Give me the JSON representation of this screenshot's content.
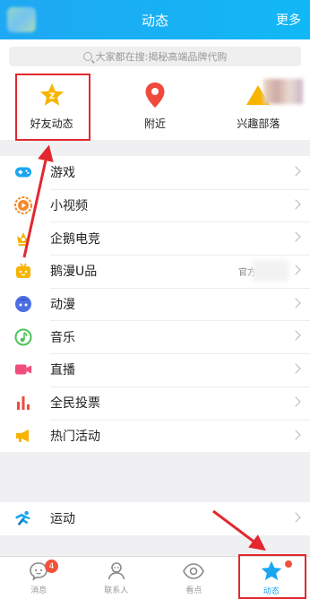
{
  "header": {
    "title": "动态",
    "more_label": "更多"
  },
  "search": {
    "placeholder": "大家都在搜:揭秘高端品牌代购"
  },
  "quick": [
    {
      "label": "好友动态",
      "icon": "friend-star-icon",
      "color": "#f7b500"
    },
    {
      "label": "附近",
      "icon": "location-pin-icon",
      "color": "#f04a3e"
    },
    {
      "label": "兴趣部落",
      "icon": "triangle-tribe-icon",
      "color": "#f7b500"
    }
  ],
  "list1": [
    {
      "label": "游戏",
      "icon": "gamepad-icon",
      "color": "#1aa6f1"
    },
    {
      "label": "小视频",
      "icon": "video-play-icon",
      "color": "#f28a2b"
    },
    {
      "label": "企鹅电竞",
      "icon": "esports-crown-icon",
      "color": "#f2b100"
    },
    {
      "label": "鹅漫U品",
      "icon": "tv-toy-icon",
      "color": "#f7b500",
      "sub": "官方正版"
    },
    {
      "label": "动漫",
      "icon": "anime-face-icon",
      "color": "#4c6fe3"
    },
    {
      "label": "音乐",
      "icon": "music-note-icon",
      "color": "#4cc35a"
    },
    {
      "label": "直播",
      "icon": "camera-icon",
      "color": "#f04e7a"
    },
    {
      "label": "全民投票",
      "icon": "bar-chart-icon",
      "color": "#f04a3e"
    },
    {
      "label": "热门活动",
      "icon": "megaphone-icon",
      "color": "#f7b500"
    }
  ],
  "list2": [
    {
      "label": "运动",
      "icon": "runner-icon",
      "color": "#1aa6f1"
    }
  ],
  "tabs": [
    {
      "label": "消息",
      "icon": "message-icon",
      "badge": "4"
    },
    {
      "label": "联系人",
      "icon": "contacts-icon"
    },
    {
      "label": "看点",
      "icon": "eye-icon"
    },
    {
      "label": "动态",
      "icon": "star-icon",
      "active": true
    }
  ],
  "colors": {
    "brand": "#1aa6f1",
    "highlight": "#e2282e",
    "badge": "#f2513b"
  }
}
